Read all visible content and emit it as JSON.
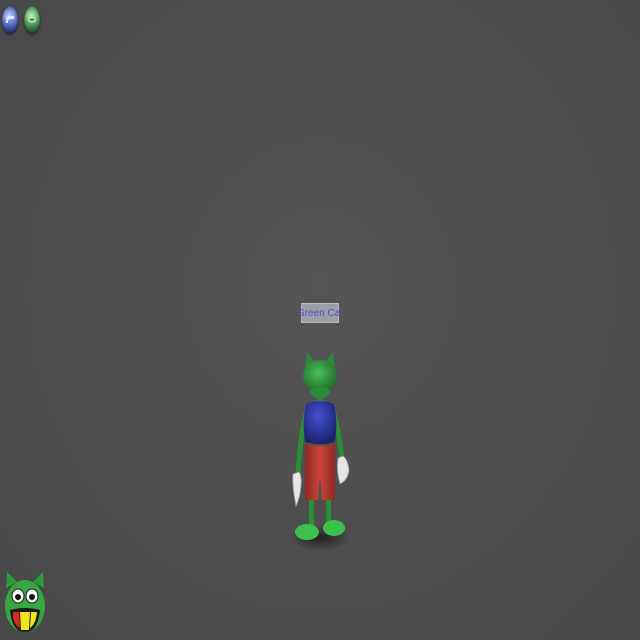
{
  "scene": {
    "background_color": "#4d4d4d"
  },
  "top_buttons": [
    {
      "name": "options-button",
      "icon": "blue-orb-icon",
      "color": "#5b6fc4"
    },
    {
      "name": "friends-button",
      "icon": "green-orb-icon",
      "color": "#4f9a5a"
    }
  ],
  "avatar": {
    "nametag": "Green Cat",
    "nametag_color": "#4b52c8",
    "head_color": "#2f9b3c",
    "shirt_color": "#2a35a8",
    "shorts_color": "#b83a2e",
    "glove_color": "#e8e8e8"
  },
  "laff_meter": {
    "icon": "green-cat-laff-meter-icon",
    "face_color": "#36a641"
  }
}
